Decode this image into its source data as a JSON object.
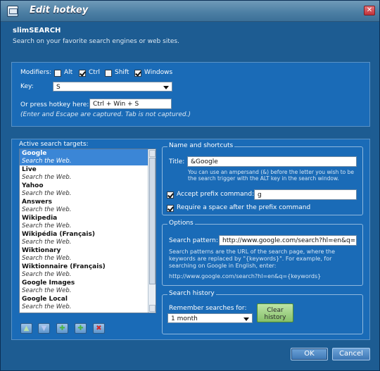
{
  "window": {
    "title": "Edit hotkey",
    "close_glyph": "✕"
  },
  "app": {
    "name": "slimSEARCH",
    "subtitle": "Search on your favorite search engines or web sites."
  },
  "hotkey": {
    "modifiers_label": "Modifiers:",
    "modifiers": [
      {
        "label": "Alt",
        "checked": false
      },
      {
        "label": "Ctrl",
        "checked": true
      },
      {
        "label": "Shift",
        "checked": false
      },
      {
        "label": "Windows",
        "checked": true
      }
    ],
    "key_label": "Key:",
    "key_value": "S",
    "press_label": "Or press hotkey here:",
    "press_value": "Ctrl + Win + S",
    "press_note": "(Enter and Escape are captured. Tab is not captured.)"
  },
  "targets": {
    "label": "Active search targets:",
    "items": [
      {
        "name": "Google",
        "desc": "Search the Web.",
        "selected": true
      },
      {
        "name": "Live",
        "desc": "Search the Web.",
        "selected": false
      },
      {
        "name": "Yahoo",
        "desc": "Search the Web.",
        "selected": false
      },
      {
        "name": "Answers",
        "desc": "Search the Web.",
        "selected": false
      },
      {
        "name": "Wikipedia",
        "desc": "Search the Web.",
        "selected": false
      },
      {
        "name": "Wikipédia (Français)",
        "desc": "Search the Web.",
        "selected": false
      },
      {
        "name": "Wiktionary",
        "desc": "Search the Web.",
        "selected": false
      },
      {
        "name": "Wiktionnaire (Français)",
        "desc": "Search the Web.",
        "selected": false
      },
      {
        "name": "Google Images",
        "desc": "Search the Web.",
        "selected": false
      },
      {
        "name": "Google Local",
        "desc": "Search the Web.",
        "selected": false
      }
    ],
    "toolbar": [
      {
        "name": "move-up-button",
        "glyph": "▲",
        "color": "#b8e0a8"
      },
      {
        "name": "move-down-button",
        "glyph": "▼",
        "color": "#b7c7f0"
      },
      {
        "name": "add-button",
        "glyph": "✚",
        "color": "#49b543"
      },
      {
        "name": "copy-add-button",
        "glyph": "✚",
        "color": "#49b543"
      },
      {
        "name": "delete-button",
        "glyph": "✖",
        "color": "#d12a2a"
      }
    ]
  },
  "shortcuts": {
    "group_title": "Name and shortcuts",
    "title_label": "Title:",
    "title_value": "&Google",
    "title_help": "You can use an ampersand (&) before the letter you wish to be the search trigger with the ALT key in the search window.",
    "prefix_label": "Accept prefix command:",
    "prefix_checked": true,
    "prefix_value": "g",
    "space_label": "Require a space after the prefix command",
    "space_checked": true
  },
  "options": {
    "group_title": "Options",
    "pattern_label": "Search pattern:",
    "pattern_value": "http://www.google.com/search?hl=en&q={keywords}",
    "pattern_help": "Search patterns are the URL of the search page, where the keywords are replaced by \"{keywords}\". For example, for searching on Google in English, enter:",
    "pattern_example": "http://www.google.com/search?hl=en&q={keywords}"
  },
  "history": {
    "group_title": "Search history",
    "remember_label": "Remember searches for:",
    "remember_value": "1 month",
    "clear_label": "Clear history"
  },
  "buttons": {
    "ok": "OK",
    "cancel": "Cancel"
  }
}
